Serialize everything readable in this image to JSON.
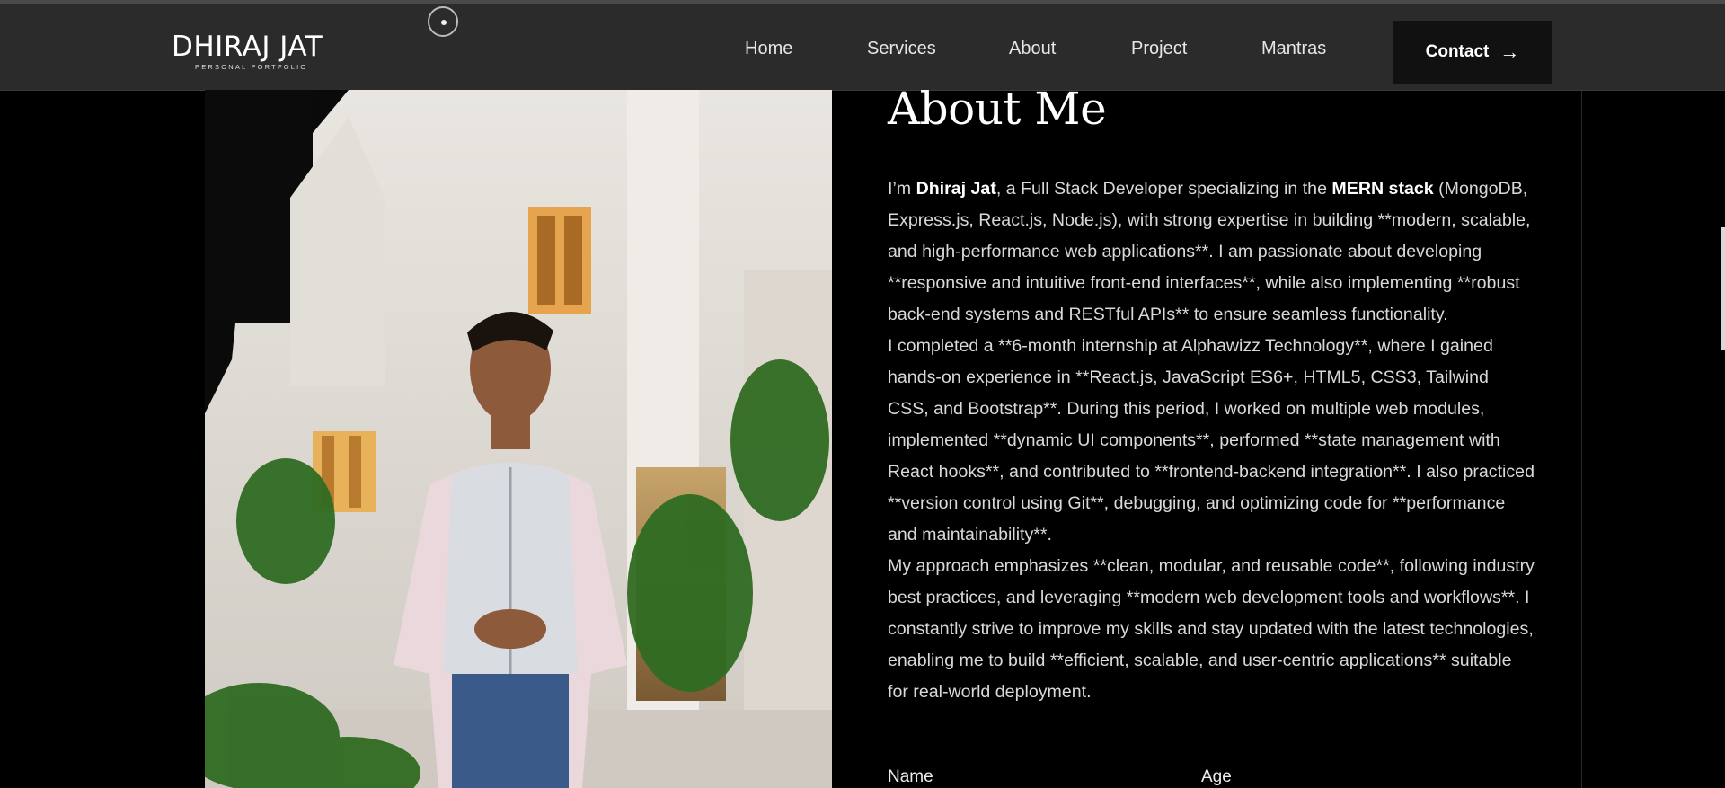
{
  "logo": {
    "title": "DHIRAJ JAT",
    "subtitle": "PERSONAL PORTFOLIO"
  },
  "nav": {
    "items": [
      "Home",
      "Services",
      "About",
      "Project",
      "Mantras"
    ],
    "contact_label": "Contact",
    "contact_icon": "arrow-right-icon"
  },
  "about": {
    "heading": "About Me",
    "p1": {
      "pre": "I’m ",
      "name": "Dhiraj Jat",
      "mid": ", a Full Stack Developer specializing in the ",
      "stack": "MERN stack",
      "post": " (MongoDB, Express.js, React.js, Node.js), with strong expertise in building **modern, scalable, and high-performance web applications**. I am passionate about developing **responsive and intuitive front-end interfaces**, while also implementing **robust back-end systems and RESTful APIs** to ensure seamless functionality."
    },
    "p2": "I completed a **6-month internship at Alphawizz Technology**, where I gained hands-on experience in **React.js, JavaScript ES6+, HTML5, CSS3, Tailwind CSS, and Bootstrap**. During this period, I worked on multiple web modules, implemented **dynamic UI components**, performed **state management with React hooks**, and contributed to **frontend-backend integration**. I also practiced **version control using Git**, debugging, and optimizing code for **performance and maintainability**.",
    "p3": "My approach emphasizes **clean, modular, and reusable code**, following industry best practices, and leveraging **modern web development tools and workflows**. I constantly strive to improve my skills and stay updated with the latest technologies, enabling me to build **efficient, scalable, and user-centric applications** suitable for real-world deployment."
  },
  "info": {
    "name_label": "Name",
    "age_label": "Age"
  },
  "colors": {
    "navbar": "#2b2b2b",
    "background": "#000000",
    "button": "#111111"
  }
}
